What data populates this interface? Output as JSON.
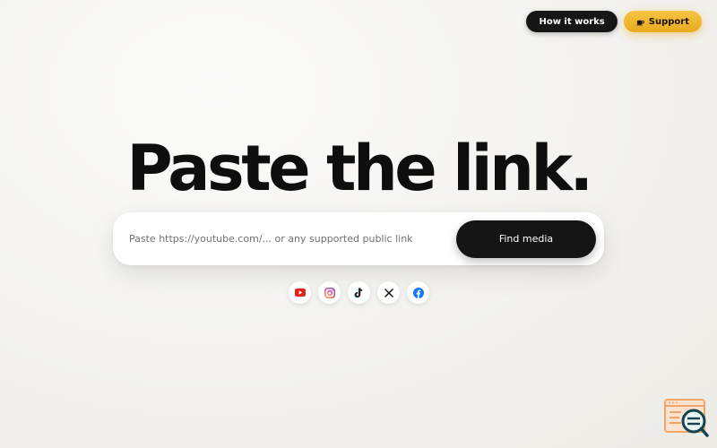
{
  "nav": {
    "how_it_works": "How it works",
    "support": "Support"
  },
  "hero": {
    "title": "Paste the link."
  },
  "search": {
    "placeholder": "Paste https://youtube.com/... or any supported public link",
    "value": "",
    "button_label": "Find media"
  },
  "platforms": [
    {
      "icon": "youtube-icon",
      "color": "#e62117"
    },
    {
      "icon": "instagram-icon",
      "color": "#d6249f"
    },
    {
      "icon": "tiktok-icon",
      "color": "#111111"
    },
    {
      "icon": "x-icon",
      "color": "#111111"
    },
    {
      "icon": "facebook-icon",
      "color": "#1877f2"
    }
  ],
  "colors": {
    "accent_dark": "#141414",
    "support_gold": "#f2b733",
    "corner_widget_orange": "#f0a66a",
    "corner_widget_teal": "#14444f"
  }
}
